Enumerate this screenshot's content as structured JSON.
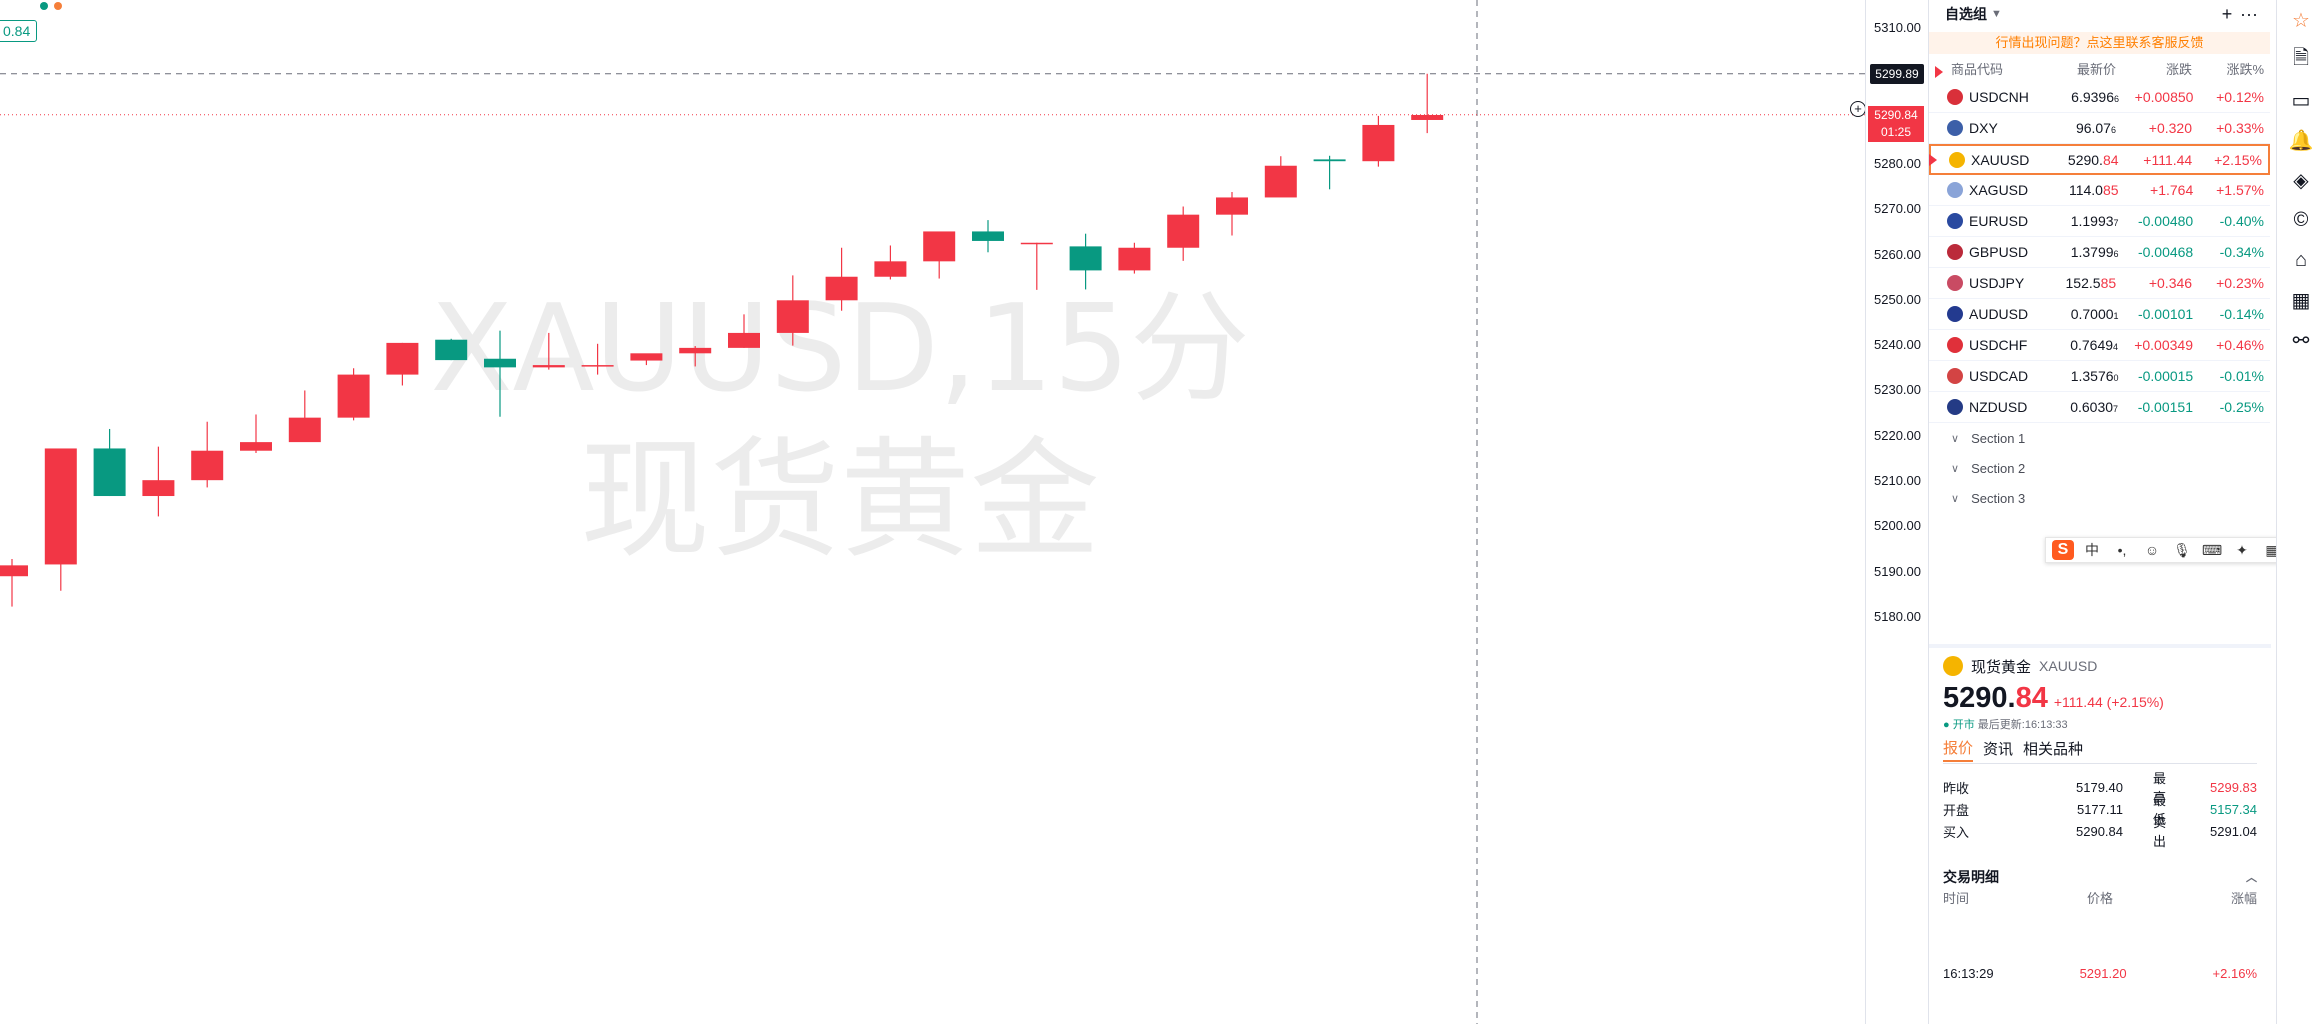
{
  "chart": {
    "watermark_line1": "XAUUSD,15分",
    "watermark_line2": "现货黄金",
    "ohlc_badge": "0.84",
    "price_ticks": [
      "5310.00",
      "5300.00",
      "5290.00",
      "5280.00",
      "5270.00",
      "5260.00",
      "5250.00",
      "5240.00",
      "5230.00",
      "5220.00",
      "5210.00",
      "5200.00",
      "5190.00",
      "5180.00"
    ],
    "crosshair_price": "5299.89",
    "last_price": "5290.84",
    "countdown": "01:25",
    "colors": {
      "up": "#f23645",
      "down": "#089981"
    }
  },
  "chart_data": {
    "type": "candlestick",
    "y_range": [
      5176,
      5314
    ],
    "candles": [
      {
        "o": 5189.0,
        "h": 5192.8,
        "l": 5182.3,
        "c": 5191.4
      },
      {
        "o": 5191.6,
        "h": 5216.7,
        "l": 5185.8,
        "c": 5217.2
      },
      {
        "o": 5217.2,
        "h": 5221.5,
        "l": 5206.7,
        "c": 5206.7
      },
      {
        "o": 5206.7,
        "h": 5217.6,
        "l": 5202.2,
        "c": 5210.2
      },
      {
        "o": 5210.2,
        "h": 5223.1,
        "l": 5208.6,
        "c": 5216.7
      },
      {
        "o": 5216.7,
        "h": 5224.7,
        "l": 5216.2,
        "c": 5218.6
      },
      {
        "o": 5218.6,
        "h": 5230.0,
        "l": 5219.1,
        "c": 5224.0
      },
      {
        "o": 5224.0,
        "h": 5234.9,
        "l": 5223.4,
        "c": 5233.5
      },
      {
        "o": 5233.5,
        "h": 5240.5,
        "l": 5231.1,
        "c": 5240.5
      },
      {
        "o": 5241.2,
        "h": 5241.4,
        "l": 5236.7,
        "c": 5236.7
      },
      {
        "o": 5237.0,
        "h": 5243.2,
        "l": 5224.2,
        "c": 5235.1
      },
      {
        "o": 5235.1,
        "h": 5242.7,
        "l": 5234.6,
        "c": 5235.6
      },
      {
        "o": 5235.5,
        "h": 5240.3,
        "l": 5233.5,
        "c": 5235.6
      },
      {
        "o": 5236.6,
        "h": 5237.7,
        "l": 5235.6,
        "c": 5238.2
      },
      {
        "o": 5238.2,
        "h": 5239.8,
        "l": 5235.3,
        "c": 5239.4
      },
      {
        "o": 5239.4,
        "h": 5246.8,
        "l": 5239.4,
        "c": 5242.7
      },
      {
        "o": 5242.7,
        "h": 5255.4,
        "l": 5239.9,
        "c": 5249.9
      },
      {
        "o": 5249.9,
        "h": 5261.5,
        "l": 5247.6,
        "c": 5255.1
      },
      {
        "o": 5255.1,
        "h": 5262.0,
        "l": 5254.5,
        "c": 5258.5
      },
      {
        "o": 5258.5,
        "h": 5263.6,
        "l": 5254.7,
        "c": 5265.1
      },
      {
        "o": 5265.1,
        "h": 5267.6,
        "l": 5260.5,
        "c": 5263.0
      },
      {
        "o": 5262.3,
        "h": 5262.6,
        "l": 5252.2,
        "c": 5262.6
      },
      {
        "o": 5261.8,
        "h": 5264.6,
        "l": 5252.3,
        "c": 5256.5
      },
      {
        "o": 5256.5,
        "h": 5262.6,
        "l": 5255.8,
        "c": 5261.5
      },
      {
        "o": 5261.5,
        "h": 5270.6,
        "l": 5258.6,
        "c": 5268.8
      },
      {
        "o": 5268.8,
        "h": 5273.8,
        "l": 5264.2,
        "c": 5272.6
      },
      {
        "o": 5272.6,
        "h": 5281.7,
        "l": 5275.2,
        "c": 5279.6
      },
      {
        "o": 5281.0,
        "h": 5281.8,
        "l": 5274.4,
        "c": 5280.6
      },
      {
        "o": 5280.6,
        "h": 5290.6,
        "l": 5279.4,
        "c": 5288.6
      },
      {
        "o": 5289.7,
        "h": 5299.9,
        "l": 5286.8,
        "c": 5290.8
      }
    ]
  },
  "watchlist": {
    "title": "自选组",
    "notice": "行情出现问题？点这里联系客服反馈",
    "columns": {
      "symbol": "商品代码",
      "last": "最新价",
      "change": "涨跌",
      "pct": "涨跌%"
    },
    "rows": [
      {
        "symbol": "USDCNH",
        "last_main": "6.9396",
        "last_sub": "6",
        "change": "+0.00850",
        "pct": "+0.12%",
        "dir": "up",
        "flag": "#d9303a"
      },
      {
        "symbol": "DXY",
        "last_main": "96.07",
        "last_sub": "6",
        "change": "+0.320",
        "pct": "+0.33%",
        "dir": "up",
        "flag": "#3c5fa8"
      },
      {
        "symbol": "XAUUSD",
        "last_main": "5290.",
        "last_sub": "84",
        "change": "+111.44",
        "pct": "+2.15%",
        "dir": "up",
        "flag": "#f5b400",
        "active": true
      },
      {
        "symbol": "XAGUSD",
        "last_main": "114.0",
        "last_sub": "85",
        "change": "+1.764",
        "pct": "+1.57%",
        "dir": "up",
        "flag": "#8aa4d8"
      },
      {
        "symbol": "EURUSD",
        "last_main": "1.1993",
        "last_sub": "7",
        "change": "-0.00480",
        "pct": "-0.40%",
        "dir": "down",
        "flag": "#2a4aa0"
      },
      {
        "symbol": "GBPUSD",
        "last_main": "1.3799",
        "last_sub": "6",
        "change": "-0.00468",
        "pct": "-0.34%",
        "dir": "down",
        "flag": "#bb2a3a"
      },
      {
        "symbol": "USDJPY",
        "last_main": "152.5",
        "last_sub": "85",
        "change": "+0.346",
        "pct": "+0.23%",
        "dir": "up",
        "flag": "#c94b63"
      },
      {
        "symbol": "AUDUSD",
        "last_main": "0.7000",
        "last_sub": "1",
        "change": "-0.00101",
        "pct": "-0.14%",
        "dir": "down",
        "flag": "#233a8f"
      },
      {
        "symbol": "USDCHF",
        "last_main": "0.7649",
        "last_sub": "4",
        "change": "+0.00349",
        "pct": "+0.46%",
        "dir": "up",
        "flag": "#e0303a"
      },
      {
        "symbol": "USDCAD",
        "last_main": "1.3576",
        "last_sub": "0",
        "change": "-0.00015",
        "pct": "-0.01%",
        "dir": "down",
        "flag": "#d34444"
      },
      {
        "symbol": "NZDUSD",
        "last_main": "0.6030",
        "last_sub": "7",
        "change": "-0.00151",
        "pct": "-0.25%",
        "dir": "down",
        "flag": "#243b85"
      }
    ],
    "sections": [
      "Section 1",
      "Section 2",
      "Section 3"
    ]
  },
  "ime": {
    "mode": "中"
  },
  "detail": {
    "name": "现货黄金",
    "symbol": "XAUUSD",
    "price_main": "5290.",
    "price_tail": "84",
    "change": "+111.44 (+2.15%)",
    "status": "● 开市",
    "updated": "最后更新:16:13:33",
    "tabs": [
      "报价",
      "资讯",
      "相关品种"
    ],
    "stats": [
      {
        "k": "昨收",
        "v": "5179.40",
        "k2": "最高",
        "v2": "5299.83",
        "v2dir": "up"
      },
      {
        "k": "开盘",
        "v": "5177.11",
        "k2": "最低",
        "v2": "5157.34",
        "v2dir": "down"
      },
      {
        "k": "买入",
        "v": "5290.84",
        "k2": "卖出",
        "v2": "5291.04",
        "v2dir": ""
      }
    ],
    "trades_title": "交易明细",
    "trade_cols": [
      "时间",
      "价格",
      "涨幅"
    ],
    "trade_row": {
      "time": "16:13:29",
      "price": "5291.20",
      "pct": "+2.16%"
    }
  }
}
